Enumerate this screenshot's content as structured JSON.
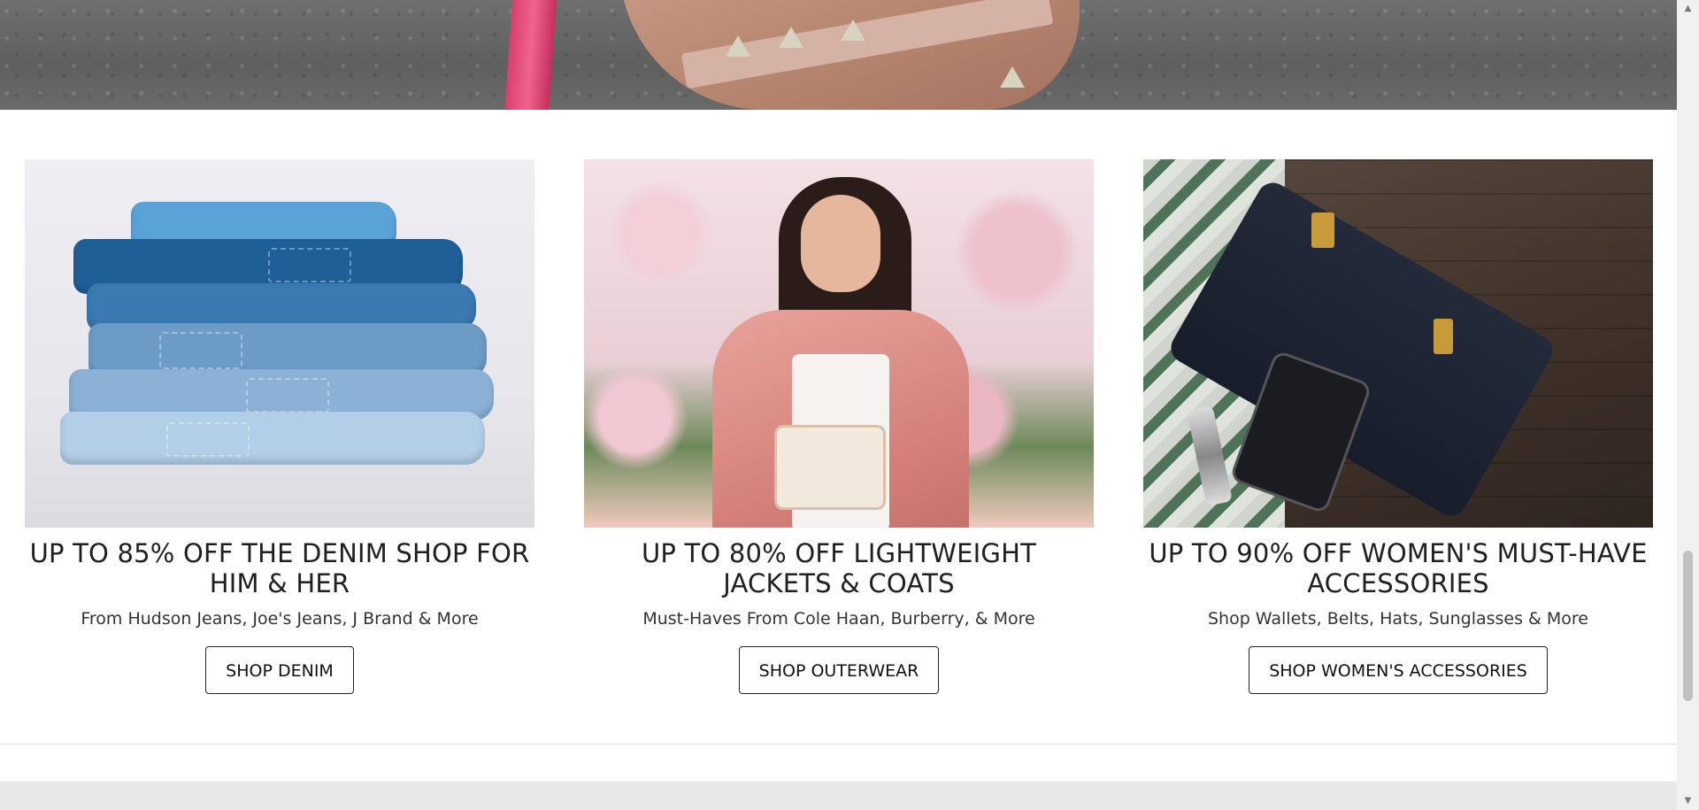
{
  "promos": [
    {
      "title": "UP TO 85% OFF THE DENIM SHOP FOR HIM & HER",
      "subtitle": "From Hudson Jeans, Joe's Jeans, J Brand & More",
      "button": "SHOP DENIM"
    },
    {
      "title": "UP TO 80% OFF LIGHTWEIGHT JACKETS & COATS",
      "subtitle": "Must-Haves From Cole Haan, Burberry, & More",
      "button": "SHOP OUTERWEAR"
    },
    {
      "title": "UP TO 90% OFF WOMEN'S MUST-HAVE ACCESSORIES",
      "subtitle": "Shop Wallets, Belts, Hats, Sunglasses & More",
      "button": "SHOP WOMEN'S ACCESSORIES"
    }
  ],
  "scrollbar": {
    "up_arrow": "▲",
    "down_arrow": "▼"
  }
}
